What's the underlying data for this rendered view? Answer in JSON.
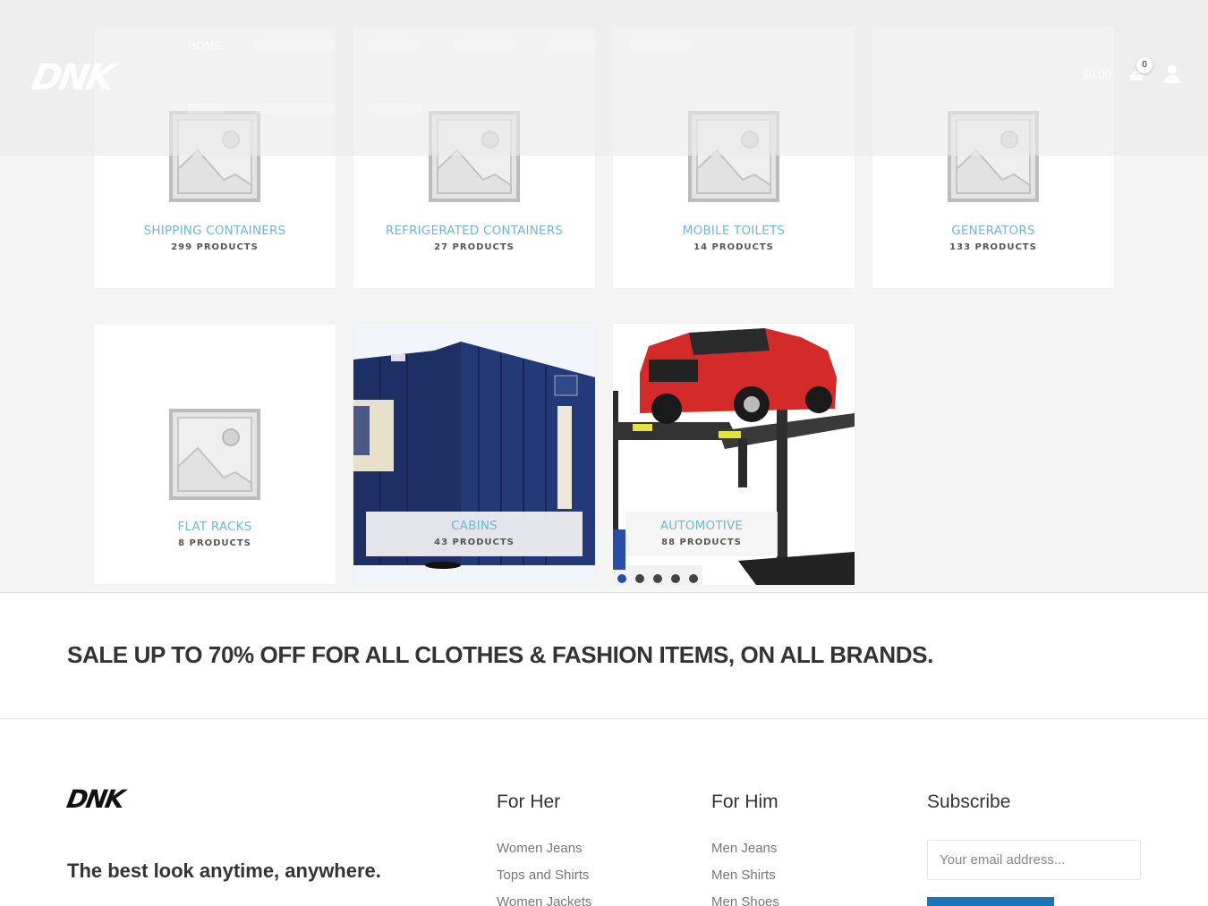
{
  "header": {
    "logo_text": "DNK",
    "nav_primary": [
      {
        "label": "HOME"
      }
    ],
    "cart_total": "$0.00",
    "cart_count": "0"
  },
  "categories": [
    {
      "title": "SHIPPING CONTAINERS",
      "count": "299 PRODUCTS",
      "image": "placeholder-image"
    },
    {
      "title": "REFRIGERATED CONTAINERS",
      "count": "27 PRODUCTS",
      "image": "placeholder-image"
    },
    {
      "title": "MOBILE TOILETS",
      "count": "14 PRODUCTS",
      "image": "placeholder-image"
    },
    {
      "title": "GENERATORS",
      "count": "133 PRODUCTS",
      "image": "placeholder-image"
    },
    {
      "title": "FLAT RACKS",
      "count": "8 PRODUCTS",
      "image": "placeholder-image"
    },
    {
      "title": "CABINS",
      "count": "43 PRODUCTS",
      "image": "blue-portable-cabin-photo"
    },
    {
      "title": "AUTOMOTIVE",
      "count": "88 PRODUCTS",
      "image": "red-truck-on-lift-photo"
    }
  ],
  "sale_banner": {
    "text": "SALE UP TO 70% OFF FOR ALL CLOTHES & FASHION ITEMS, ON ALL BRANDS."
  },
  "footer": {
    "logo_text": "DNK",
    "tagline": "The best look anytime, anywhere.",
    "for_her": {
      "heading": "For Her",
      "links": [
        "Women Jeans",
        "Tops and Shirts",
        "Women Jackets"
      ]
    },
    "for_him": {
      "heading": "For Him",
      "links": [
        "Men Jeans",
        "Men Shirts",
        "Men Shoes"
      ]
    },
    "subscribe": {
      "heading": "Subscribe",
      "email_placeholder": "Your email address...",
      "email_value": ""
    }
  },
  "colors": {
    "category_title": "#6fb7cf",
    "subscribe_button": "#1a73b8",
    "text_dark": "#333333"
  }
}
